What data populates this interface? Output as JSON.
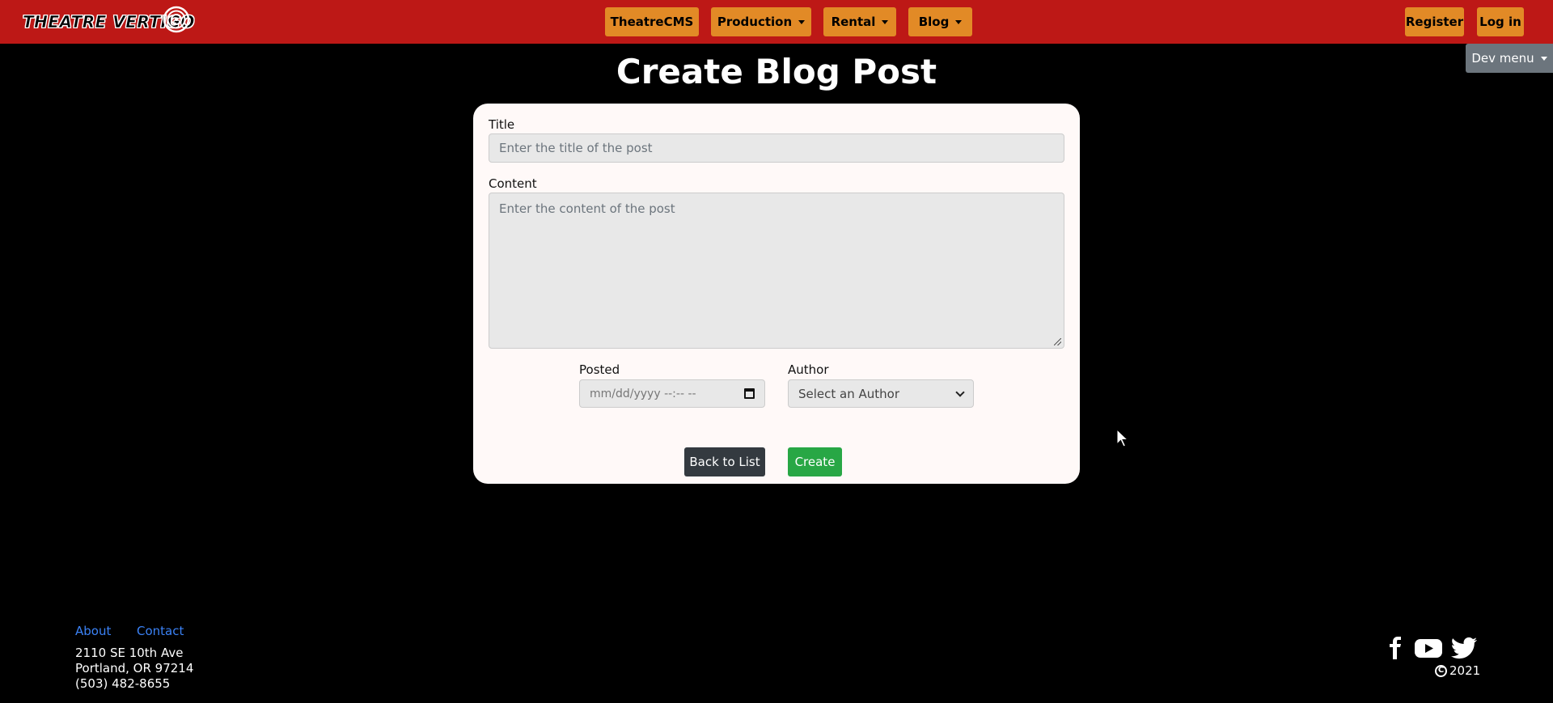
{
  "navbar": {
    "logo_text": "THEATRE VERTIGO",
    "items": [
      {
        "label": "TheatreCMS",
        "dropdown": false
      },
      {
        "label": "Production",
        "dropdown": true
      },
      {
        "label": "Rental",
        "dropdown": true
      },
      {
        "label": "Blog",
        "dropdown": true
      }
    ],
    "register_label": "Register",
    "login_label": "Log in",
    "dev_menu_label": "Dev menu"
  },
  "page": {
    "title": "Create Blog Post"
  },
  "form": {
    "title_label": "Title",
    "title_placeholder": "Enter the title of the post",
    "content_label": "Content",
    "content_placeholder": "Enter the content of the post",
    "posted_label": "Posted",
    "posted_placeholder": "mm/dd/yyyy --:-- --",
    "author_label": "Author",
    "author_selected": "Select an Author",
    "back_label": "Back to List",
    "create_label": "Create"
  },
  "footer": {
    "about_label": "About",
    "contact_label": "Contact",
    "address_line1": "2110 SE 10th Ave",
    "address_line2": "Portland, OR 97214",
    "phone": "(503) 482-8655",
    "copyright_year": "2021",
    "social_icons": [
      "facebook-icon",
      "youtube-icon",
      "twitter-icon"
    ]
  },
  "colors": {
    "navbar_bg": "#bd1816",
    "nav_button": "#e28a26",
    "card_bg": "#fff9f8",
    "create_button": "#28a745",
    "back_button": "#343a40",
    "dev_menu": "#6c757d",
    "link": "#3b82f6"
  }
}
